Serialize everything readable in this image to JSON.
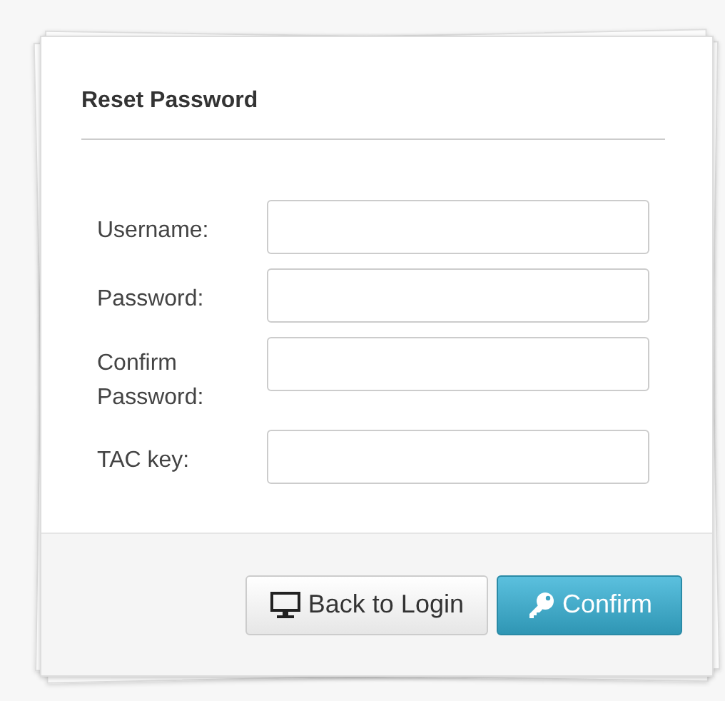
{
  "panel": {
    "title": "Reset Password"
  },
  "fields": [
    {
      "label": "Username:"
    },
    {
      "label": "Password:"
    },
    {
      "label": "Confirm Password:"
    },
    {
      "label": "TAC key:"
    }
  ],
  "buttons": [
    {
      "kind": "back",
      "label": "Back to Login"
    },
    {
      "kind": "confirm",
      "label": "Confirm"
    }
  ]
}
